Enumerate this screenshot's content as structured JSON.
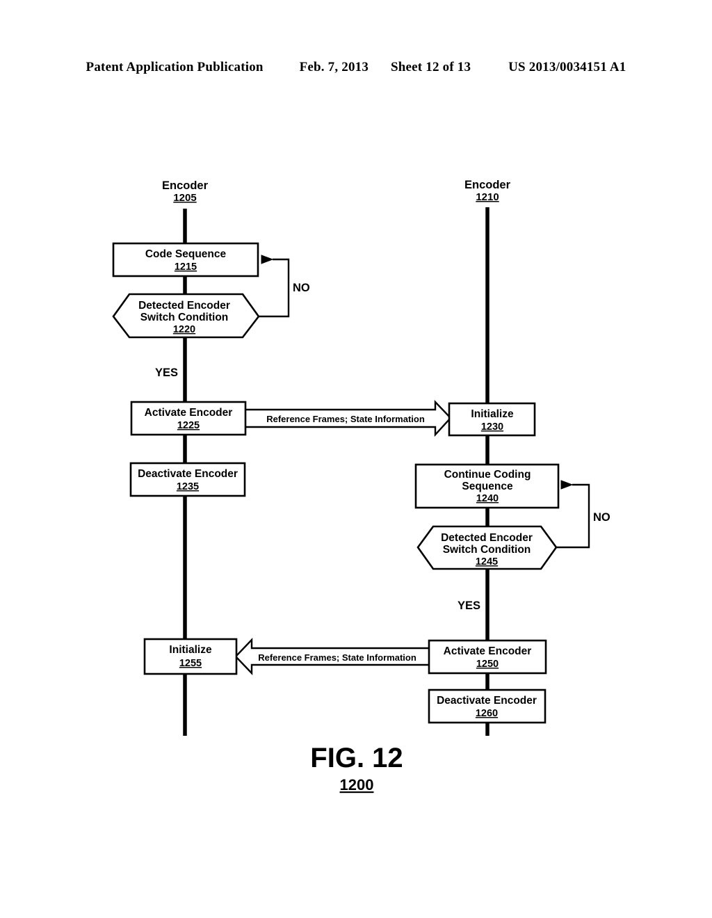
{
  "header": {
    "publication": "Patent Application Publication",
    "date": "Feb. 7, 2013",
    "sheet": "Sheet 12 of 13",
    "number": "US 2013/0034151 A1"
  },
  "figure": {
    "caption": "FIG. 12",
    "caption_ref": "1200"
  },
  "lanes": [
    {
      "id": "lane-left",
      "title": "Encoder",
      "ref": "1205"
    },
    {
      "id": "lane-right",
      "title": "Encoder",
      "ref": "1210"
    }
  ],
  "nodes": {
    "code_sequence": {
      "label": "Code Sequence",
      "ref": "1215",
      "shape": "process"
    },
    "detect_switch_left": {
      "label_line1": "Detected Encoder",
      "label_line2": "Switch Condition",
      "ref": "1220",
      "shape": "decision"
    },
    "activate_left": {
      "label": "Activate Encoder",
      "ref": "1225",
      "shape": "process"
    },
    "initialize_right": {
      "label": "Initialize",
      "ref": "1230",
      "shape": "process"
    },
    "deactivate_left": {
      "label": "Deactivate Encoder",
      "ref": "1235",
      "shape": "process"
    },
    "continue_coding": {
      "label_line1": "Continue Coding",
      "label_line2": "Sequence",
      "ref": "1240",
      "shape": "process"
    },
    "detect_switch_right": {
      "label_line1": "Detected Encoder",
      "label_line2": "Switch Condition",
      "ref": "1245",
      "shape": "decision"
    },
    "activate_right": {
      "label": "Activate Encoder",
      "ref": "1250",
      "shape": "process"
    },
    "initialize_left": {
      "label": "Initialize",
      "ref": "1255",
      "shape": "process"
    },
    "deactivate_right": {
      "label": "Deactivate Encoder",
      "ref": "1260",
      "shape": "process"
    }
  },
  "edges": {
    "no_left": "NO",
    "yes_left": "YES",
    "no_right": "NO",
    "yes_right": "YES",
    "transfer_ltr": "Reference Frames; State Information",
    "transfer_rtl": "Reference Frames; State Information"
  },
  "colors": {
    "ink": "#000000",
    "paper": "#ffffff"
  }
}
